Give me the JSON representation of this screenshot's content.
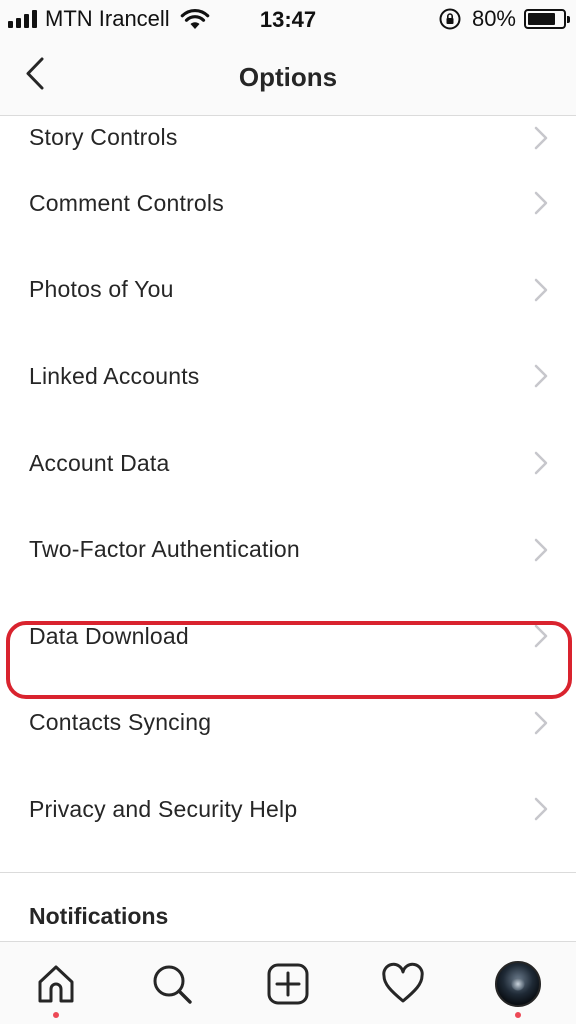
{
  "status_bar": {
    "carrier": "MTN Irancell",
    "time": "13:47",
    "battery_percent": "80%",
    "battery_level": 0.8,
    "signal_bars": 4
  },
  "header": {
    "title": "Options",
    "back_icon": "chevron-left-icon"
  },
  "options": [
    {
      "label": "Story Controls"
    },
    {
      "label": "Comment Controls"
    },
    {
      "label": "Photos of You"
    },
    {
      "label": "Linked Accounts"
    },
    {
      "label": "Account Data"
    },
    {
      "label": "Two-Factor Authentication"
    },
    {
      "label": "Data Download",
      "highlighted": true
    },
    {
      "label": "Contacts Syncing"
    },
    {
      "label": "Privacy and Security Help"
    }
  ],
  "sections": {
    "notifications": "Notifications"
  },
  "tab_bar": {
    "items": [
      "home-icon",
      "search-icon",
      "add-post-icon",
      "heart-icon",
      "profile-avatar"
    ],
    "active": "home-icon"
  },
  "colors": {
    "highlight": "#d9232e",
    "notification_dot": "#ed4956",
    "text": "#262626",
    "divider": "#dbdbdb"
  }
}
